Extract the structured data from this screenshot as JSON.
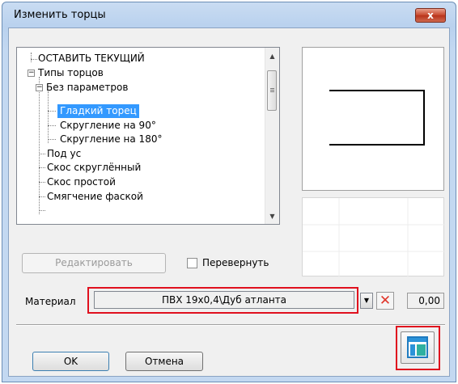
{
  "window": {
    "title": "Изменить торцы",
    "close_label": "x"
  },
  "tree": {
    "items": [
      {
        "label": "ОСТАВИТЬ ТЕКУЩИЙ"
      },
      {
        "label": "Типы торцов",
        "expander": "−"
      },
      {
        "label": "Без параметров",
        "expander": "−"
      },
      {
        "label": "Гладкий торец",
        "selected": true
      },
      {
        "label": "Скругление на 90°"
      },
      {
        "label": "Скругление на 180°"
      },
      {
        "label": "Под ус"
      },
      {
        "label": "Скос скруглённый"
      },
      {
        "label": "Скос простой"
      },
      {
        "label": "Смягчение фаской"
      }
    ]
  },
  "buttons": {
    "edit": "Редактировать",
    "ok": "OK",
    "cancel": "Отмена"
  },
  "flip_checkbox": {
    "label": "Перевернуть",
    "checked": false
  },
  "material": {
    "label": "Материал",
    "value": "ПВХ 19x0,4\\Дуб атланта",
    "amount": "0,00"
  },
  "icons": {
    "close": "close-icon",
    "dropdown": "chevron-down-icon",
    "clear": "clear-x-icon",
    "layout": "layout-panel-icon"
  },
  "colors": {
    "selection": "#3399ff",
    "highlight": "#e0101e",
    "clear_icon": "#e0352a"
  }
}
